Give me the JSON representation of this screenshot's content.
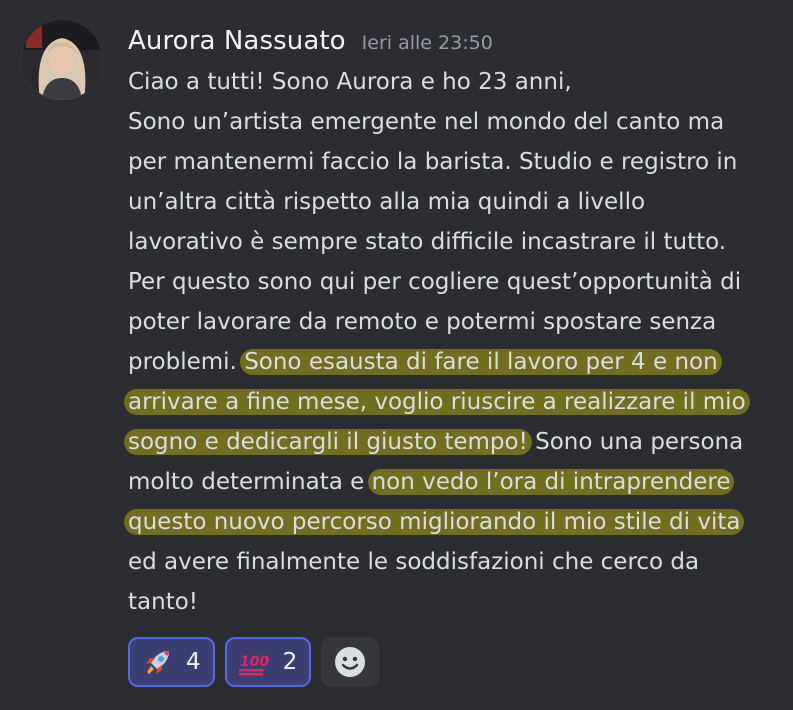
{
  "message": {
    "author": "Aurora Nassuato",
    "timestamp": "Ieri alle 23:50",
    "lines": [
      [
        {
          "t": "Ciao a tutti! Sono Aurora e ho 23 anni,",
          "h": false
        }
      ],
      [
        {
          "t": "Sono un’artista emergente nel mondo del canto ma",
          "h": false
        }
      ],
      [
        {
          "t": "per mantenermi faccio la barista. Studio e registro in",
          "h": false
        }
      ],
      [
        {
          "t": "un’altra città rispetto alla mia quindi a livello",
          "h": false
        }
      ],
      [
        {
          "t": "lavorativo è sempre stato difficile incastrare il tutto.",
          "h": false
        }
      ],
      [
        {
          "t": "Per questo sono qui per cogliere quest’opportunità di",
          "h": false
        }
      ],
      [
        {
          "t": "poter lavorare da remoto e potermi spostare senza",
          "h": false
        }
      ],
      [
        {
          "t": "problemi. ",
          "h": false
        },
        {
          "t": "Sono esausta di fare il lavoro per 4 e non",
          "h": true
        }
      ],
      [
        {
          "t": "arrivare a fine mese, voglio riuscire a realizzare il mio",
          "h": true
        }
      ],
      [
        {
          "t": "sogno e dedicargli il giusto tempo!",
          "h": true
        },
        {
          "t": " Sono una persona",
          "h": false
        }
      ],
      [
        {
          "t": "molto determinata e ",
          "h": false
        },
        {
          "t": "non vedo l’ora di intraprendere",
          "h": true
        }
      ],
      [
        {
          "t": "questo nuovo percorso migliorando il mio stile di vita",
          "h": true
        }
      ],
      [
        {
          "t": "ed avere finalmente le soddisfazioni che cerco da",
          "h": false
        }
      ],
      [
        {
          "t": "tanto!",
          "h": false
        }
      ]
    ]
  },
  "reactions": [
    {
      "emoji": "rocket-emoji",
      "count": "4"
    },
    {
      "emoji": "hundred-points-emoji",
      "count": "2"
    }
  ],
  "add_reaction_icon": "smiley-add-reaction-icon",
  "colors": {
    "background": "#2b2d31",
    "highlight": "#969414",
    "reaction_border": "#5865f2"
  }
}
